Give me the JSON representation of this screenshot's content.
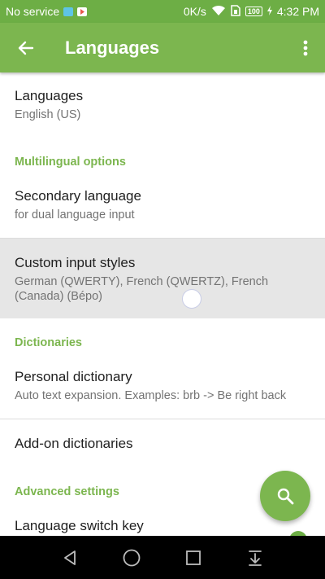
{
  "status_bar": {
    "carrier": "No service",
    "network_speed": "0K/s",
    "battery_level": "100",
    "time": "4:32 PM",
    "icons": [
      "message-icon",
      "play-store-icon",
      "wifi-icon",
      "sim-icon",
      "battery-icon",
      "charging-icon"
    ]
  },
  "app_bar": {
    "title": "Languages",
    "icons": [
      "back-arrow-icon",
      "more-vert-icon"
    ]
  },
  "items": {
    "languages": {
      "title": "Languages",
      "summary": "English (US)"
    },
    "secondary_language": {
      "title": "Secondary language",
      "summary": "for dual language input"
    },
    "custom_input_styles": {
      "title": "Custom input styles",
      "summary": "German (QWERTY), French (QWERTZ), French (Canada) (Bépo)"
    },
    "personal_dictionary": {
      "title": "Personal dictionary",
      "summary": "Auto text expansion. Examples: brb -> Be right back"
    },
    "addon_dictionaries": {
      "title": "Add-on dictionaries"
    },
    "language_switch_key": {
      "title": "Language switch key"
    }
  },
  "categories": {
    "multilingual": "Multilingual options",
    "dictionaries": "Dictionaries",
    "advanced": "Advanced settings"
  },
  "fab": {
    "icon": "search-icon"
  },
  "nav_bar": {
    "icons": [
      "back-triangle-icon",
      "home-circle-icon",
      "recents-square-icon",
      "notification-pulldown-icon"
    ]
  },
  "colors": {
    "accent": "#7cb64f",
    "status_bar": "#6dae45",
    "highlight": "#e6e6e6"
  }
}
